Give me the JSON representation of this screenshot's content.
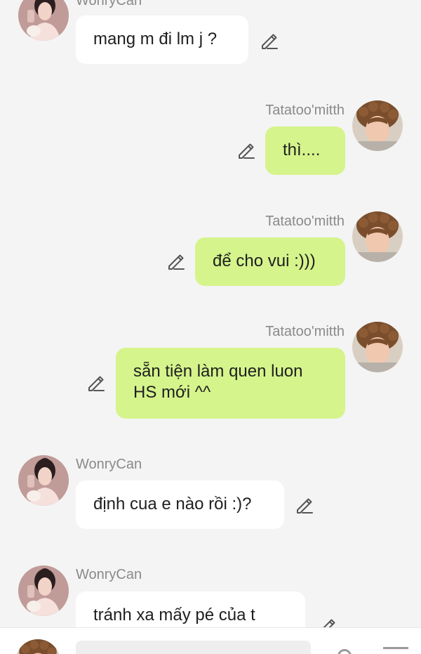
{
  "messages": [
    {
      "sender": "WonryCan",
      "text": "mang m đi lm j ?",
      "direction": "incoming"
    },
    {
      "sender": "Tatatoo'mitth",
      "text": "thì....",
      "direction": "outgoing"
    },
    {
      "sender": "Tatatoo'mitth",
      "text": "để cho vui :)))",
      "direction": "outgoing"
    },
    {
      "sender": "Tatatoo'mitth",
      "text": "sẵn tiện làm quen luon HS mới ^^",
      "direction": "outgoing"
    },
    {
      "sender": "WonryCan",
      "text": "định cua e nào rồi :)?",
      "direction": "incoming"
    },
    {
      "sender": "WonryCan",
      "text": "tránh xa mấy pé của t",
      "direction": "incoming"
    }
  ],
  "colors": {
    "background": "#f4f4f4",
    "incoming_bubble": "#ffffff",
    "outgoing_bubble": "#d5f48c",
    "sender_name": "#8a8a8a"
  },
  "icons": {
    "edit": "pencil-edit-icon",
    "composer_left": "emoji-icon",
    "composer_right": "menu-icon"
  }
}
